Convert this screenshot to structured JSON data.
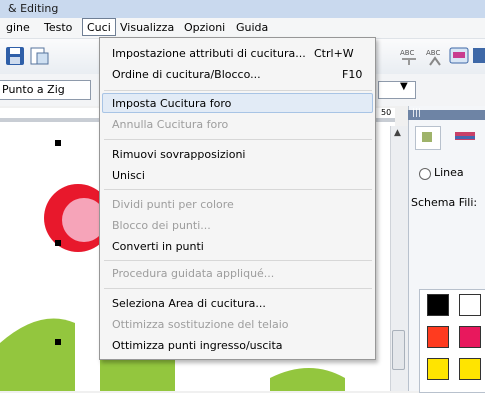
{
  "window": {
    "title": "& Editing"
  },
  "menubar": {
    "items": [
      "gine",
      "Testo",
      "Cuci",
      "Visualizza",
      "Opzioni",
      "Guida"
    ]
  },
  "toolbar": {
    "stitch_type": "Punto a Zig"
  },
  "ruler": {
    "mark": "50"
  },
  "dropdown": {
    "groups": [
      [
        {
          "label": "Impostazione attributi di cucitura...",
          "shortcut": "Ctrl+W",
          "enabled": true
        },
        {
          "label": "Ordine di cucitura/Blocco...",
          "shortcut": "F10",
          "enabled": true
        }
      ],
      [
        {
          "label": "Imposta Cucitura foro",
          "enabled": true,
          "highlighted": true
        },
        {
          "label": "Annulla Cucitura foro",
          "enabled": false
        }
      ],
      [
        {
          "label": "Rimuovi sovrapposizioni",
          "enabled": true
        },
        {
          "label": "Unisci",
          "enabled": true
        }
      ],
      [
        {
          "label": "Dividi punti per colore",
          "enabled": false
        },
        {
          "label": "Blocco dei punti...",
          "enabled": false
        },
        {
          "label": "Converti in punti",
          "enabled": true
        }
      ],
      [
        {
          "label": "Procedura guidata appliqué...",
          "enabled": false
        }
      ],
      [
        {
          "label": "Seleziona Area di cucitura...",
          "enabled": true
        },
        {
          "label": "Ottimizza sostituzione del telaio",
          "enabled": false
        },
        {
          "label": "Ottimizza punti ingresso/uscita",
          "enabled": true
        }
      ]
    ]
  },
  "panel": {
    "line_label": "Linea",
    "thread_label": "Schema Fili:",
    "swatch_colors": [
      "#000000",
      "#ffffff",
      "#ff3b1f",
      "#e8185d",
      "#ffe400",
      "#ffe400"
    ]
  },
  "colors": {
    "leaf": "#93c63e",
    "flower_red": "#e8182c",
    "flower_pink": "#f6a4b9",
    "accent": "#6e84a5"
  }
}
